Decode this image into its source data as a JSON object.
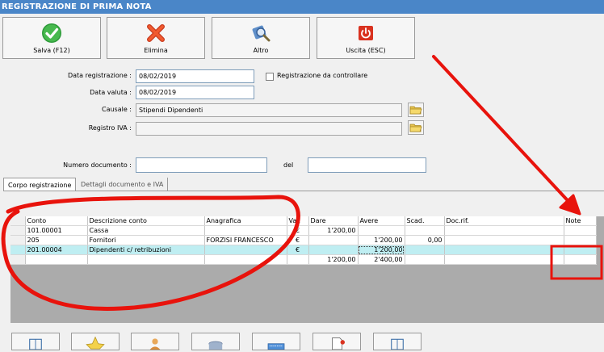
{
  "window": {
    "title": "REGISTRAZIONE DI PRIMA NOTA"
  },
  "toolbar": [
    {
      "label": "Salva (F12)",
      "icon": "checkmark-icon"
    },
    {
      "label": "Elimina",
      "icon": "delete-x-icon"
    },
    {
      "label": "Altro",
      "icon": "gear-search-icon"
    },
    {
      "label": "Uscita (ESC)",
      "icon": "power-icon"
    }
  ],
  "form": {
    "data_registrazione_label": "Data registrazione :",
    "data_registrazione": "08/02/2019",
    "da_controllare_label": "Registrazione da controllare",
    "data_valuta_label": "Data valuta :",
    "data_valuta": "08/02/2019",
    "causale_label": "Causale :",
    "causale": "Stipendi Dipendenti",
    "registro_iva_label": "Registro IVA :",
    "registro_iva": "",
    "numero_documento_label": "Numero documento :",
    "numero_documento": "",
    "del_label": "del",
    "del_value": ""
  },
  "tabs": [
    {
      "label": "Corpo registrazione",
      "active": true
    },
    {
      "label": "Dettagli documento e IVA",
      "active": false
    }
  ],
  "grid": {
    "headers": [
      "Conto",
      "Descrizione conto",
      "Anagrafica",
      "Val.",
      "Dare",
      "Avere",
      "Scad.",
      "Doc.rif.",
      "Note"
    ],
    "rows": [
      [
        "101.00001",
        "Cassa",
        "",
        "€",
        "1'200,00",
        "",
        "",
        "",
        ""
      ],
      [
        "205",
        "Fornitori",
        "FORZISI FRANCESCO",
        "€",
        "",
        "1'200,00",
        "0,00",
        "",
        ""
      ],
      [
        "201.00004",
        "Dipendenti c/ retribuzioni",
        "",
        "€",
        "",
        "1'200,00",
        "",
        "",
        ""
      ]
    ],
    "totals": {
      "dare": "1'200,00",
      "avere": "2'400,00"
    }
  },
  "colors": {
    "title_bar": "#4a86c8",
    "selected_row": "#bfeef2",
    "annotation": "#e8130c"
  }
}
